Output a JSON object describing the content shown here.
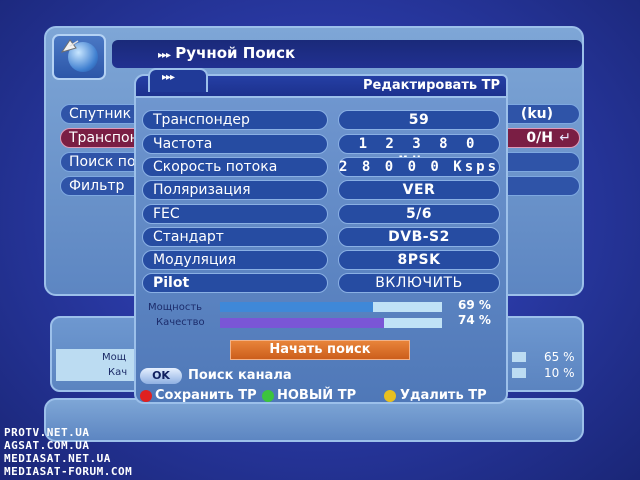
{
  "background_screen": {
    "title": "Ручной Поиск",
    "arrows": "▸▸▸",
    "rows": [
      {
        "label": "Спутник",
        "value": "(ku)"
      },
      {
        "label": "Транспон",
        "value": "0/H"
      },
      {
        "label": "Поиск по",
        "value": ""
      },
      {
        "label": "Фильтр",
        "value": ""
      }
    ],
    "stats": [
      {
        "label": "Мощ",
        "percent": "65 %"
      },
      {
        "label": "Кач",
        "percent": "10 %"
      }
    ]
  },
  "dialog": {
    "tab_arrows": "▸▸▸",
    "title": "Редактировать ТР",
    "fields": [
      {
        "label": "Транспондер",
        "value": "59"
      },
      {
        "label": "Частота",
        "value": "1 2 3 8 0  MHz"
      },
      {
        "label": "Скорость потока",
        "value": "2 8 0 0 0 Ksps"
      },
      {
        "label": "Поляризация",
        "value": "VER"
      },
      {
        "label": "FEC",
        "value": "5/6"
      },
      {
        "label": "Стандарт",
        "value": "DVB-S2"
      },
      {
        "label": "Модуляция",
        "value": "8PSK"
      },
      {
        "label": "Pilot",
        "value": "ВКЛЮЧИТЬ"
      }
    ],
    "meters": [
      {
        "label": "Мощность",
        "percent_text": "69 %",
        "level": 0.69
      },
      {
        "label": "Качество",
        "percent_text": "74 %",
        "level": 0.74
      }
    ],
    "start_button": "Начать поиск",
    "ok_key": "OK",
    "ok_hint": "Поиск канала",
    "color_hints": [
      {
        "color": "#e02020",
        "label": "Сохранить ТР"
      },
      {
        "color": "#3cc43c",
        "label": "НОВЫЙ ТР"
      },
      {
        "color": "#e8c020",
        "label": "Удалить ТР"
      }
    ]
  },
  "colors": {
    "accent_selected": "#7a1e44",
    "start_button": "#e8843a",
    "power_bar": "#3f88d8",
    "quality_bar": "#7a56d6"
  },
  "watermarks": [
    "PROTV.NET.UA",
    "AGSAT.COM.UA",
    "MEDIASAT.NET.UA",
    "MEDIASAT-FORUM.COM"
  ]
}
